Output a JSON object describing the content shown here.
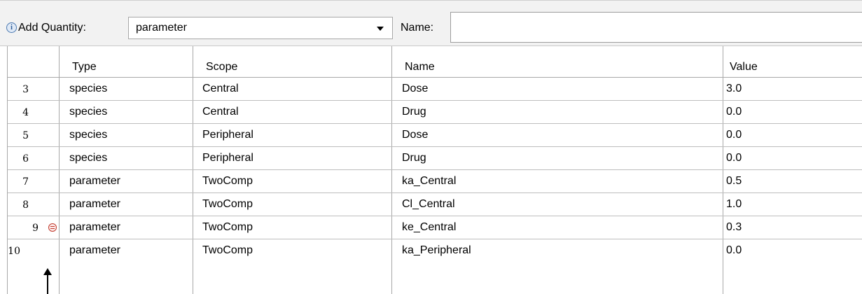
{
  "toolbar": {
    "add_quantity_label": "Add Quantity:",
    "quantity_type_selected": "parameter",
    "name_label": "Name:",
    "name_value": ""
  },
  "table": {
    "columns": [
      "Type",
      "Scope",
      "Name",
      "Value"
    ],
    "rows": [
      {
        "num": "3",
        "type": "species",
        "scope": "Central",
        "name": "Dose",
        "value": "3.0"
      },
      {
        "num": "4",
        "type": "species",
        "scope": "Central",
        "name": "Drug",
        "value": "0.0"
      },
      {
        "num": "5",
        "type": "species",
        "scope": "Peripheral",
        "name": "Dose",
        "value": "0.0"
      },
      {
        "num": "6",
        "type": "species",
        "scope": "Peripheral",
        "name": "Drug",
        "value": "0.0"
      },
      {
        "num": "7",
        "type": "parameter",
        "scope": "TwoComp",
        "name": "ka_Central",
        "value": "0.5"
      },
      {
        "num": "8",
        "type": "parameter",
        "scope": "TwoComp",
        "name": "Cl_Central",
        "value": "1.0"
      },
      {
        "num": "9",
        "type": "parameter",
        "scope": "TwoComp",
        "name": "ke_Central",
        "value": "0.3"
      },
      {
        "num": "10",
        "type": "parameter",
        "scope": "TwoComp",
        "name": "ka_Peripheral",
        "value": "0.0"
      }
    ],
    "remove_icon_row": "9"
  },
  "icons": {
    "info": "info-icon",
    "remove": "remove-row-icon",
    "dropdown": "chevron-down-icon",
    "annotation": "up-arrow-icon"
  },
  "colors": {
    "toolbar_bg": "#f2f2f2",
    "grid_line": "#a8a8a8",
    "remove_icon": "#c0392b"
  }
}
